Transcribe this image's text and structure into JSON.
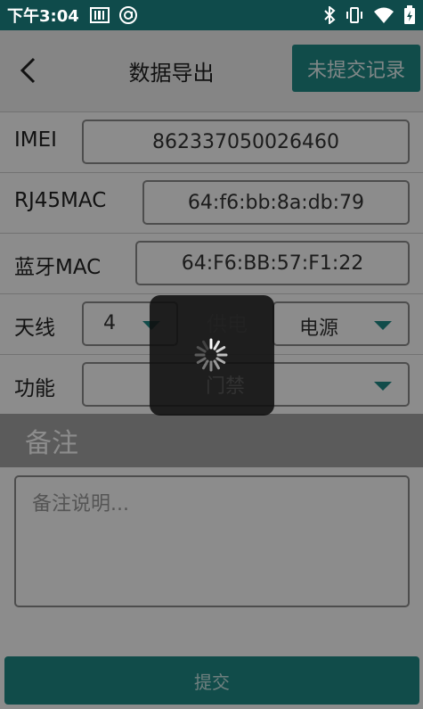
{
  "status_bar": {
    "time": "下午3:04",
    "left_icons": [
      "barcode-icon",
      "at-sign-icon"
    ],
    "right_icons": [
      "bluetooth-icon",
      "vibrate-icon",
      "wifi-icon",
      "battery-icon"
    ]
  },
  "toolbar": {
    "title": "数据导出",
    "records_button": "未提交记录"
  },
  "form": {
    "imei": {
      "label": "IMEI",
      "value": "862337050026460"
    },
    "rj45mac": {
      "label": "RJ45MAC",
      "value": "64:f6:bb:8a:db:79"
    },
    "bluetooth_mac": {
      "label": "蓝牙MAC",
      "value": "64:F6:BB:57:F1:22"
    },
    "antenna": {
      "label": "天线",
      "value": "4"
    },
    "power_supply": {
      "label": "供电",
      "value": "电源"
    },
    "function": {
      "label": "功能",
      "value": "门禁"
    }
  },
  "notes": {
    "header": "备注",
    "placeholder": "备注说明..."
  },
  "submit_button": "提交",
  "colors": {
    "status_bar": "#0f4b4b",
    "accent": "#1f8a88",
    "overlay": "rgba(0,0,0,0.45)"
  }
}
